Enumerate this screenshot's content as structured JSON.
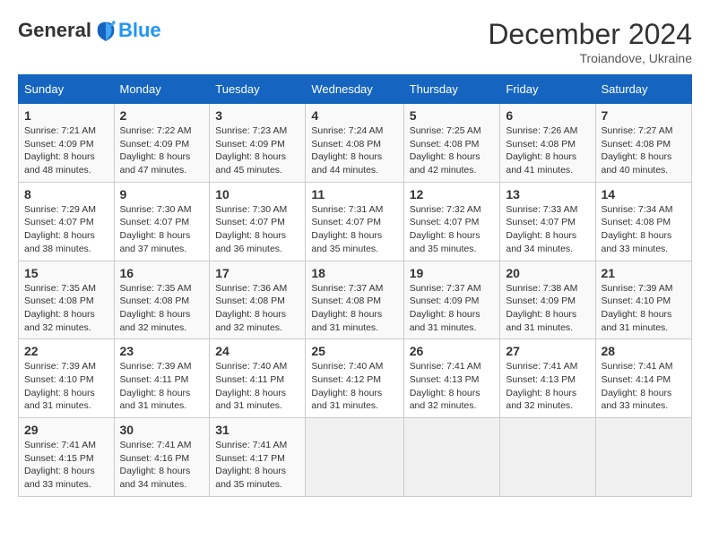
{
  "header": {
    "logo_general": "General",
    "logo_blue": "Blue",
    "month_title": "December 2024",
    "location": "Troiandove, Ukraine"
  },
  "weekdays": [
    "Sunday",
    "Monday",
    "Tuesday",
    "Wednesday",
    "Thursday",
    "Friday",
    "Saturday"
  ],
  "weeks": [
    [
      {
        "day": "1",
        "sunrise": "7:21 AM",
        "sunset": "4:09 PM",
        "daylight": "8 hours and 48 minutes."
      },
      {
        "day": "2",
        "sunrise": "7:22 AM",
        "sunset": "4:09 PM",
        "daylight": "8 hours and 47 minutes."
      },
      {
        "day": "3",
        "sunrise": "7:23 AM",
        "sunset": "4:09 PM",
        "daylight": "8 hours and 45 minutes."
      },
      {
        "day": "4",
        "sunrise": "7:24 AM",
        "sunset": "4:08 PM",
        "daylight": "8 hours and 44 minutes."
      },
      {
        "day": "5",
        "sunrise": "7:25 AM",
        "sunset": "4:08 PM",
        "daylight": "8 hours and 42 minutes."
      },
      {
        "day": "6",
        "sunrise": "7:26 AM",
        "sunset": "4:08 PM",
        "daylight": "8 hours and 41 minutes."
      },
      {
        "day": "7",
        "sunrise": "7:27 AM",
        "sunset": "4:08 PM",
        "daylight": "8 hours and 40 minutes."
      }
    ],
    [
      {
        "day": "8",
        "sunrise": "7:29 AM",
        "sunset": "4:07 PM",
        "daylight": "8 hours and 38 minutes."
      },
      {
        "day": "9",
        "sunrise": "7:30 AM",
        "sunset": "4:07 PM",
        "daylight": "8 hours and 37 minutes."
      },
      {
        "day": "10",
        "sunrise": "7:30 AM",
        "sunset": "4:07 PM",
        "daylight": "8 hours and 36 minutes."
      },
      {
        "day": "11",
        "sunrise": "7:31 AM",
        "sunset": "4:07 PM",
        "daylight": "8 hours and 35 minutes."
      },
      {
        "day": "12",
        "sunrise": "7:32 AM",
        "sunset": "4:07 PM",
        "daylight": "8 hours and 35 minutes."
      },
      {
        "day": "13",
        "sunrise": "7:33 AM",
        "sunset": "4:07 PM",
        "daylight": "8 hours and 34 minutes."
      },
      {
        "day": "14",
        "sunrise": "7:34 AM",
        "sunset": "4:08 PM",
        "daylight": "8 hours and 33 minutes."
      }
    ],
    [
      {
        "day": "15",
        "sunrise": "7:35 AM",
        "sunset": "4:08 PM",
        "daylight": "8 hours and 32 minutes."
      },
      {
        "day": "16",
        "sunrise": "7:35 AM",
        "sunset": "4:08 PM",
        "daylight": "8 hours and 32 minutes."
      },
      {
        "day": "17",
        "sunrise": "7:36 AM",
        "sunset": "4:08 PM",
        "daylight": "8 hours and 32 minutes."
      },
      {
        "day": "18",
        "sunrise": "7:37 AM",
        "sunset": "4:08 PM",
        "daylight": "8 hours and 31 minutes."
      },
      {
        "day": "19",
        "sunrise": "7:37 AM",
        "sunset": "4:09 PM",
        "daylight": "8 hours and 31 minutes."
      },
      {
        "day": "20",
        "sunrise": "7:38 AM",
        "sunset": "4:09 PM",
        "daylight": "8 hours and 31 minutes."
      },
      {
        "day": "21",
        "sunrise": "7:39 AM",
        "sunset": "4:10 PM",
        "daylight": "8 hours and 31 minutes."
      }
    ],
    [
      {
        "day": "22",
        "sunrise": "7:39 AM",
        "sunset": "4:10 PM",
        "daylight": "8 hours and 31 minutes."
      },
      {
        "day": "23",
        "sunrise": "7:39 AM",
        "sunset": "4:11 PM",
        "daylight": "8 hours and 31 minutes."
      },
      {
        "day": "24",
        "sunrise": "7:40 AM",
        "sunset": "4:11 PM",
        "daylight": "8 hours and 31 minutes."
      },
      {
        "day": "25",
        "sunrise": "7:40 AM",
        "sunset": "4:12 PM",
        "daylight": "8 hours and 31 minutes."
      },
      {
        "day": "26",
        "sunrise": "7:41 AM",
        "sunset": "4:13 PM",
        "daylight": "8 hours and 32 minutes."
      },
      {
        "day": "27",
        "sunrise": "7:41 AM",
        "sunset": "4:13 PM",
        "daylight": "8 hours and 32 minutes."
      },
      {
        "day": "28",
        "sunrise": "7:41 AM",
        "sunset": "4:14 PM",
        "daylight": "8 hours and 33 minutes."
      }
    ],
    [
      {
        "day": "29",
        "sunrise": "7:41 AM",
        "sunset": "4:15 PM",
        "daylight": "8 hours and 33 minutes."
      },
      {
        "day": "30",
        "sunrise": "7:41 AM",
        "sunset": "4:16 PM",
        "daylight": "8 hours and 34 minutes."
      },
      {
        "day": "31",
        "sunrise": "7:41 AM",
        "sunset": "4:17 PM",
        "daylight": "8 hours and 35 minutes."
      },
      null,
      null,
      null,
      null
    ]
  ]
}
